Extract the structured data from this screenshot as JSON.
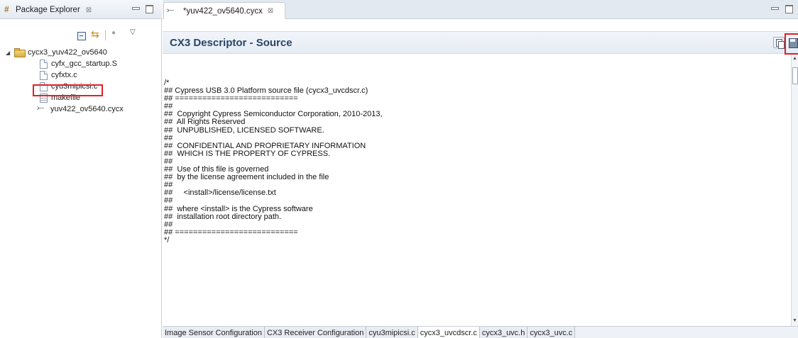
{
  "package_explorer": {
    "tab_label": "Package Explorer",
    "tab_close_glyph": "⊠",
    "project": {
      "name": "cycx3_yuv422_ov5640",
      "files": [
        {
          "name": "cyfx_gcc_startup.S",
          "icon": "file-icon"
        },
        {
          "name": "cyfxtx.c",
          "icon": "file-icon"
        },
        {
          "name": "cyu3mipicsi.c",
          "icon": "file-icon",
          "highlighted": true
        },
        {
          "name": "makefile",
          "icon": "makefile-icon"
        },
        {
          "name": "yuv422_ov5640.cycx",
          "icon": "cycx-icon"
        }
      ]
    }
  },
  "editor": {
    "tab_label": "*yuv422_ov5640.cycx",
    "tab_close_glyph": "⊠",
    "header_title": "CX3 Descriptor - Source",
    "source_lines": [
      "/*",
      "## Cypress USB 3.0 Platform source file (cycx3_uvcdscr.c)",
      "## ===========================",
      "##",
      "##  Copyright Cypress Semiconductor Corporation, 2010-2013,",
      "##  All Rights Reserved",
      "##  UNPUBLISHED, LICENSED SOFTWARE.",
      "##",
      "##  CONFIDENTIAL AND PROPRIETARY INFORMATION",
      "##  WHICH IS THE PROPERTY OF CYPRESS.",
      "##",
      "##  Use of this file is governed",
      "##  by the license agreement included in the file",
      "##",
      "##     <install>/license/license.txt",
      "##",
      "##  where <install> is the Cypress software",
      "##  installation root directory path.",
      "##",
      "## ===========================",
      "*/"
    ],
    "bottom_tabs": [
      {
        "label": "Image Sensor Configuration",
        "active": false
      },
      {
        "label": "CX3 Receiver Configuration",
        "active": false
      },
      {
        "label": "cyu3mipicsi.c",
        "active": false
      },
      {
        "label": "cycx3_uvcdscr.c",
        "active": true
      },
      {
        "label": "cycx3_uvc.h",
        "active": false
      },
      {
        "label": "cycx3_uvc.c",
        "active": false
      }
    ]
  },
  "colors": {
    "highlight_box": "#e0202a",
    "header_title": "#2a4468"
  }
}
